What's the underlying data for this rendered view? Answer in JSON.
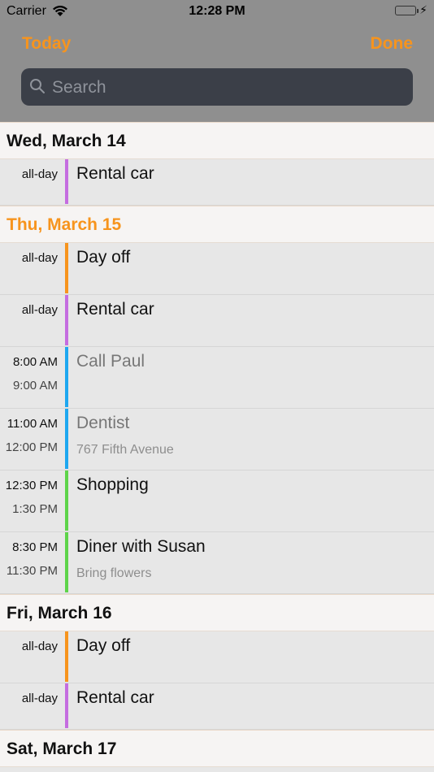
{
  "status_bar": {
    "carrier": "Carrier",
    "time": "12:28 PM",
    "battery_color": "#4cd964"
  },
  "nav": {
    "today_label": "Today",
    "done_label": "Done",
    "accent_color": "#f7941d"
  },
  "search": {
    "placeholder": "Search",
    "icon": "search-icon"
  },
  "sections": [
    {
      "date": "Wed, March 14",
      "today": false,
      "events": [
        {
          "start": "all-day",
          "title": "Rental car",
          "color": "#c56de0"
        }
      ]
    },
    {
      "date": "Thu, March 15",
      "today": true,
      "events": [
        {
          "start": "all-day",
          "title": "Day off",
          "color": "#f7941d"
        },
        {
          "start": "all-day",
          "title": "Rental car",
          "color": "#c56de0"
        },
        {
          "start": "8:00 AM",
          "end": "9:00 AM",
          "title": "Call Paul",
          "color": "#1ea7f0",
          "past": true
        },
        {
          "start": "11:00 AM",
          "end": "12:00 PM",
          "title": "Dentist",
          "subtitle": "767 Fifth Avenue",
          "color": "#1ea7f0",
          "past": true
        },
        {
          "start": "12:30 PM",
          "end": "1:30 PM",
          "title": "Shopping",
          "color": "#5ed44a"
        },
        {
          "start": "8:30 PM",
          "end": "11:30 PM",
          "title": "Diner with Susan",
          "subtitle": "Bring flowers",
          "color": "#5ed44a"
        }
      ]
    },
    {
      "date": "Fri, March 16",
      "today": false,
      "events": [
        {
          "start": "all-day",
          "title": "Day off",
          "color": "#f7941d"
        },
        {
          "start": "all-day",
          "title": "Rental car",
          "color": "#c56de0"
        }
      ]
    },
    {
      "date": "Sat, March 17",
      "today": false,
      "events": []
    }
  ]
}
